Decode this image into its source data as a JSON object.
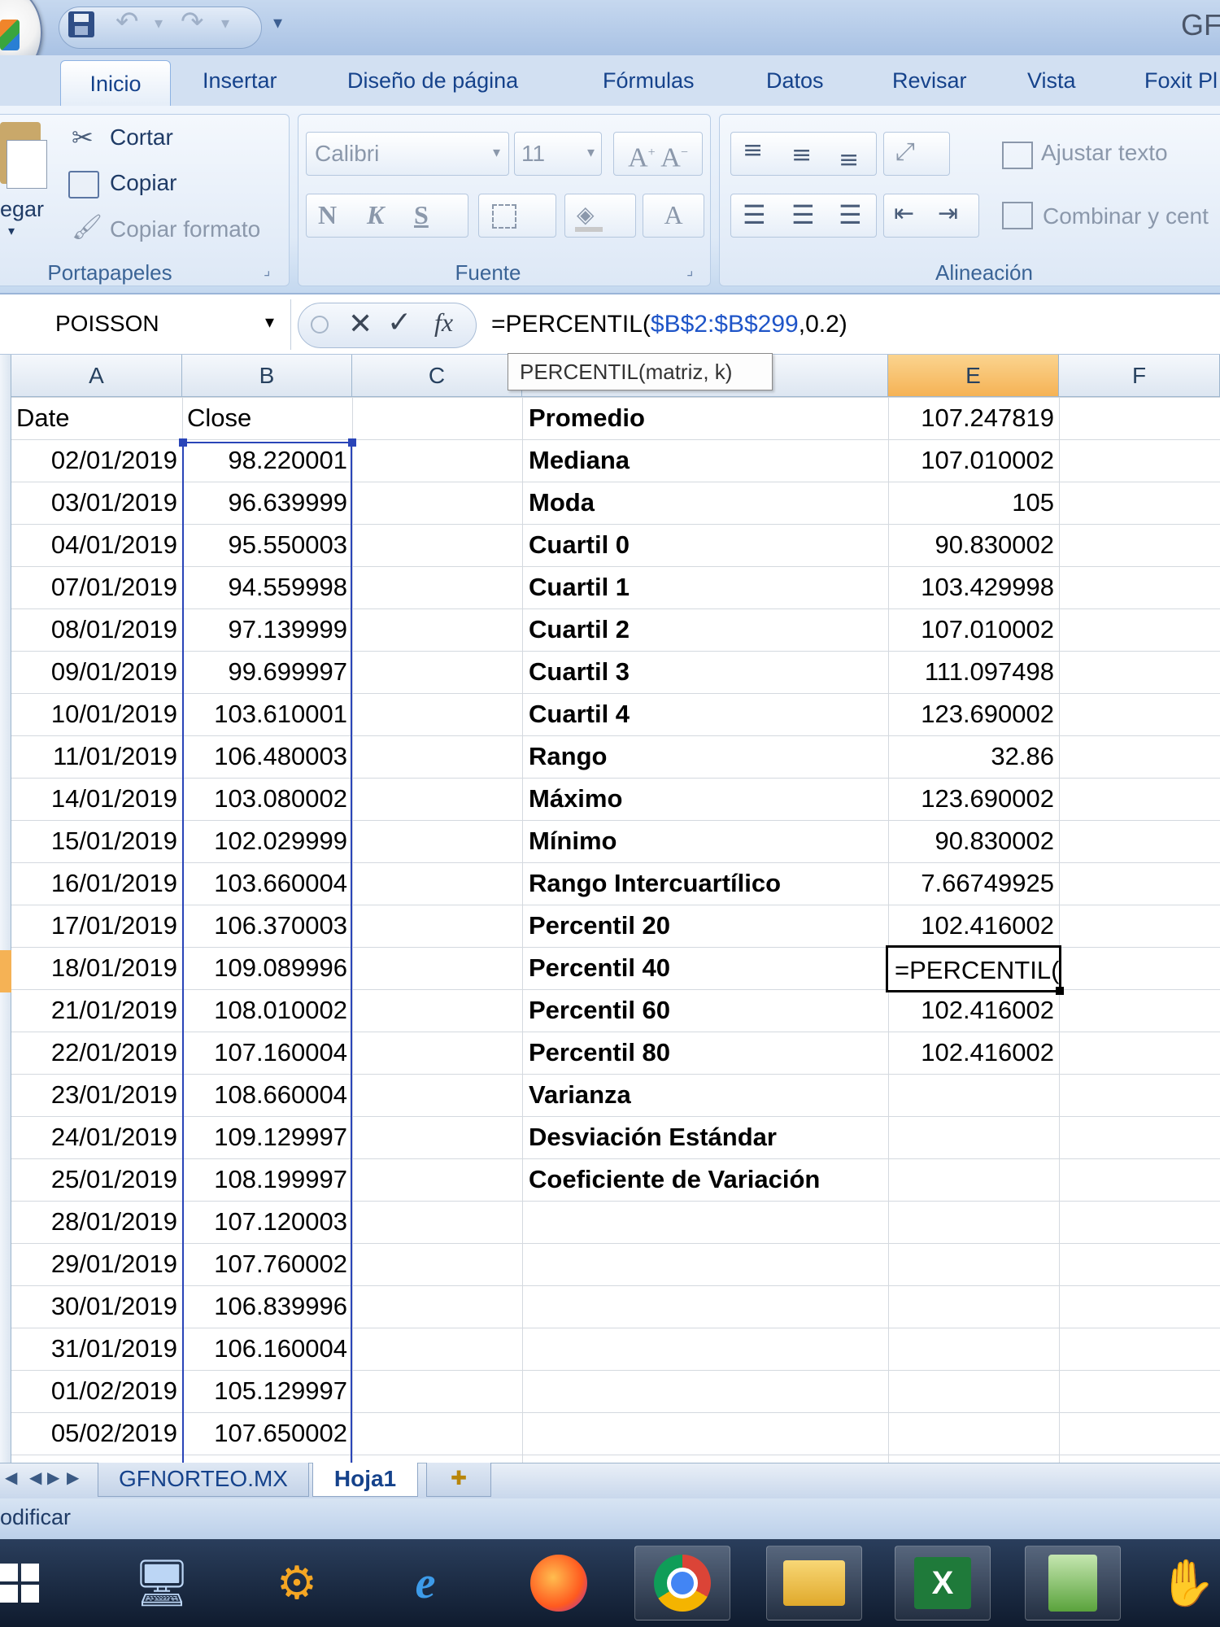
{
  "app": {
    "title": "GF"
  },
  "tabs": [
    "Inicio",
    "Insertar",
    "Diseño de página",
    "Fórmulas",
    "Datos",
    "Revisar",
    "Vista",
    "Foxit Pl"
  ],
  "ribbon": {
    "clipboard": {
      "label": "Portapapeles",
      "paste": "egar",
      "cut": "Cortar",
      "copy": "Copiar",
      "format_painter": "Copiar formato"
    },
    "font": {
      "label": "Fuente",
      "name": "Calibri",
      "size": "11",
      "bold": "N",
      "italic": "K",
      "underline": "S"
    },
    "alignment": {
      "label": "Alineación",
      "wrap_text": "Ajustar texto",
      "merge_center": "Combinar y cent"
    }
  },
  "formula_bar": {
    "name_box": "POISSON",
    "formula_prefix": "=PERCENTIL(",
    "formula_ref": "$B$2:$B$299",
    "formula_suffix": ",0.2)",
    "tooltip": "PERCENTIL(matriz, k)"
  },
  "columns": [
    "A",
    "B",
    "C",
    "E",
    "F"
  ],
  "col_a_header": "Date",
  "col_b_header": "Close",
  "prices": [
    {
      "date": "02/01/2019",
      "close": "98.220001"
    },
    {
      "date": "03/01/2019",
      "close": "96.639999"
    },
    {
      "date": "04/01/2019",
      "close": "95.550003"
    },
    {
      "date": "07/01/2019",
      "close": "94.559998"
    },
    {
      "date": "08/01/2019",
      "close": "97.139999"
    },
    {
      "date": "09/01/2019",
      "close": "99.699997"
    },
    {
      "date": "10/01/2019",
      "close": "103.610001"
    },
    {
      "date": "11/01/2019",
      "close": "106.480003"
    },
    {
      "date": "14/01/2019",
      "close": "103.080002"
    },
    {
      "date": "15/01/2019",
      "close": "102.029999"
    },
    {
      "date": "16/01/2019",
      "close": "103.660004"
    },
    {
      "date": "17/01/2019",
      "close": "106.370003"
    },
    {
      "date": "18/01/2019",
      "close": "109.089996"
    },
    {
      "date": "21/01/2019",
      "close": "108.010002"
    },
    {
      "date": "22/01/2019",
      "close": "107.160004"
    },
    {
      "date": "23/01/2019",
      "close": "108.660004"
    },
    {
      "date": "24/01/2019",
      "close": "109.129997"
    },
    {
      "date": "25/01/2019",
      "close": "108.199997"
    },
    {
      "date": "28/01/2019",
      "close": "107.120003"
    },
    {
      "date": "29/01/2019",
      "close": "107.760002"
    },
    {
      "date": "30/01/2019",
      "close": "106.839996"
    },
    {
      "date": "31/01/2019",
      "close": "106.160004"
    },
    {
      "date": "01/02/2019",
      "close": "105.129997"
    },
    {
      "date": "05/02/2019",
      "close": "107.650002"
    }
  ],
  "stats": [
    {
      "label": "Promedio",
      "value": "107.247819"
    },
    {
      "label": "Mediana",
      "value": "107.010002"
    },
    {
      "label": "Moda",
      "value": "105"
    },
    {
      "label": "Cuartil 0",
      "value": "90.830002"
    },
    {
      "label": "Cuartil 1",
      "value": "103.429998"
    },
    {
      "label": "Cuartil 2",
      "value": "107.010002"
    },
    {
      "label": "Cuartil 3",
      "value": "111.097498"
    },
    {
      "label": "Cuartil 4",
      "value": "123.690002"
    },
    {
      "label": "Rango",
      "value": "32.86"
    },
    {
      "label": "Máximo",
      "value": "123.690002"
    },
    {
      "label": "Mínimo",
      "value": "90.830002"
    },
    {
      "label": "Rango Intercuartílico",
      "value": "7.66749925"
    },
    {
      "label": "Percentil 20",
      "value": "102.416002"
    },
    {
      "label": "Percentil 40",
      "value": ""
    },
    {
      "label": "Percentil 60",
      "value": "102.416002"
    },
    {
      "label": "Percentil 80",
      "value": "102.416002"
    },
    {
      "label": "Varianza",
      "value": ""
    },
    {
      "label": "Desviación Estándar",
      "value": ""
    },
    {
      "label": "Coeficiente de Variación",
      "value": ""
    }
  ],
  "active_cell_text": "=PERCENTIL(",
  "sheets": [
    "GFNORTEO.MX",
    "Hoja1"
  ],
  "status": "odificar",
  "colors": {
    "selection": "#2a45b8",
    "active_header": "#f5b255",
    "ribbon_text": "#15428b"
  }
}
